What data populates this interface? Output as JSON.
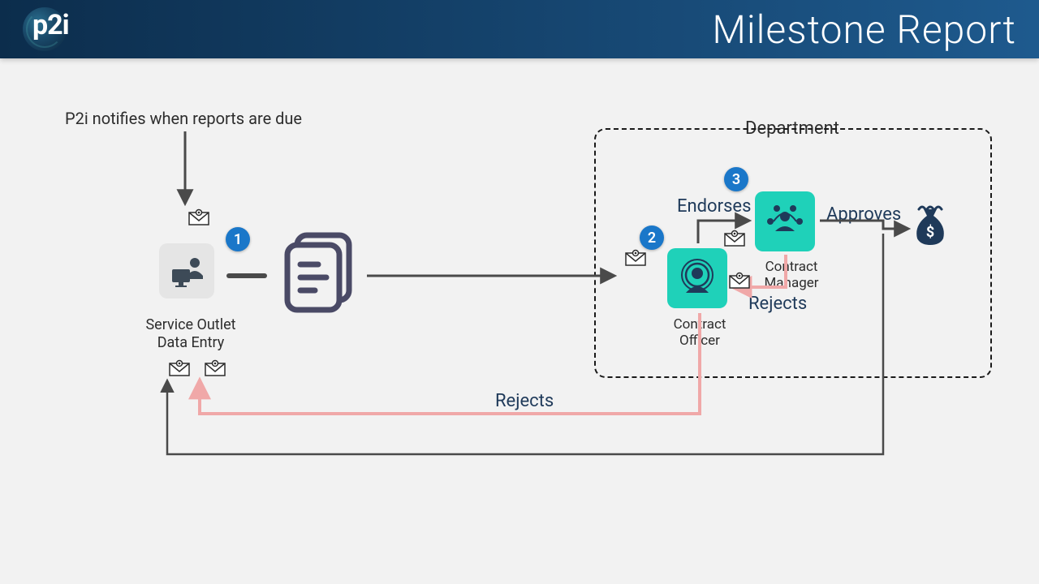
{
  "header": {
    "logo_text": "p2i",
    "title": "Milestone Report"
  },
  "diagram": {
    "notify_label": "P2i notifies when reports are due",
    "service_outlet_label_line1": "Service Outlet",
    "service_outlet_label_line2": "Data Entry",
    "department_label": "Department",
    "endorses_label": "Endorses",
    "approves_label": "Approves",
    "rejects_label_cm": "Rejects",
    "rejects_label_co": "Rejects",
    "contract_officer_label_line1": "Contract",
    "contract_officer_label_line2": "Officer",
    "contract_manager_label_line1": "Contract",
    "contract_manager_label_line2": "Manager",
    "badges": {
      "one": "1",
      "two": "2",
      "three": "3"
    }
  }
}
